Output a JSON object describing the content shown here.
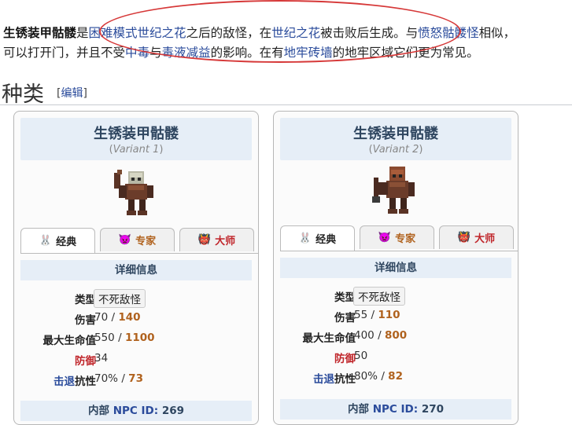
{
  "intro": {
    "line1": {
      "bold_name": "生锈装甲骷髅",
      "t1": "是",
      "link1": "困难模式",
      "link2": "世纪之花",
      "t2": "之后的敌怪，在",
      "link3": "世纪之花",
      "t3": "被击败后生成。与",
      "link4": "愤怒骷髅怪",
      "t4": "相似，"
    },
    "line2": {
      "t1": "可以打开门，并且不受",
      "link1": "中毒",
      "t2": "与",
      "link2": "毒液减益",
      "t3": "的影响。在有",
      "link3": "地牢砖墙",
      "t4": "的地牢区域它们更为常见。"
    }
  },
  "section": {
    "title": "种类",
    "edit": "编辑"
  },
  "tabs": {
    "classic": "经典",
    "expert": "专家",
    "master": "大师"
  },
  "labels": {
    "details": "详细信息",
    "type": "类型",
    "damage": "伤害",
    "max_life": "最大生命值",
    "defense": "防御",
    "kb_link": "击退",
    "kb_rest": "抗性",
    "npc_prefix": "内部 ",
    "npc_id": "NPC ID:",
    "sep": "/",
    "variant_word": "Variant"
  },
  "cards": [
    {
      "name": "生锈装甲骷髅",
      "variant_num": "1",
      "type": "不死敌怪",
      "damage": "70",
      "damage_expert": "140",
      "life": "550",
      "life_expert": "1100",
      "defense": "34",
      "kb": "70%",
      "kb_expert": "73",
      "npc_id": "269"
    },
    {
      "name": "生锈装甲骷髅",
      "variant_num": "2",
      "type": "不死敌怪",
      "damage": "55",
      "damage_expert": "110",
      "life": "400",
      "life_expert": "800",
      "defense": "50",
      "kb": "80%",
      "kb_expert": "82",
      "npc_id": "270"
    }
  ],
  "colors": {
    "link": "#2a4b9b",
    "expert": "#b0621e",
    "master": "#c0262b",
    "annotation": "#d63838",
    "header_bg": "#e6eef7"
  }
}
